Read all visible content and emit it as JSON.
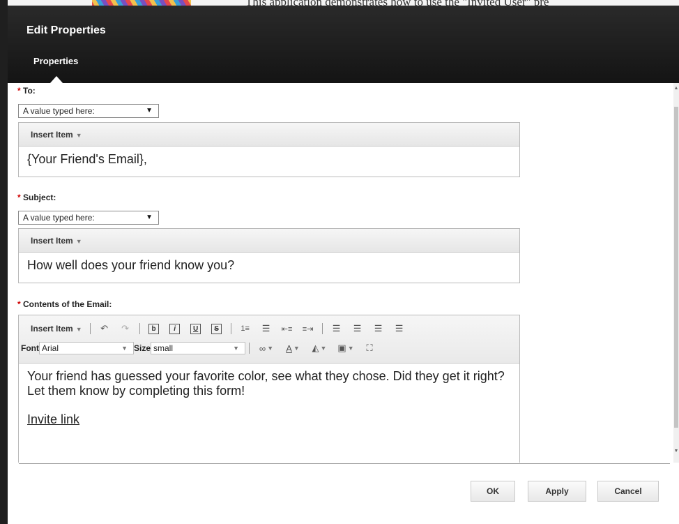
{
  "background": {
    "text": "This application demonstrates how to use the \"Invited User\" pre"
  },
  "dialog": {
    "title": "Edit Properties",
    "tab": "Properties"
  },
  "fields": {
    "required_mark": "*",
    "to": {
      "label": "To:",
      "select_value": "A value typed here:",
      "insert_item": "Insert Item",
      "value": "{Your Friend's Email},"
    },
    "subject": {
      "label": "Subject:",
      "select_value": "A value typed here:",
      "insert_item": "Insert Item",
      "value": "How well does your friend know you?"
    },
    "contents": {
      "label": "Contents of the Email:",
      "insert_item": "Insert Item",
      "font_label": "Font",
      "font_value": "Arial",
      "size_label": "Size",
      "size_value": "small",
      "body_text": "Your friend has guessed your favorite color, see what they chose.  Did they get it right?  Let them know by completing this form!",
      "link_text": "Invite link"
    }
  },
  "buttons": {
    "ok": "OK",
    "apply": "Apply",
    "cancel": "Cancel"
  }
}
